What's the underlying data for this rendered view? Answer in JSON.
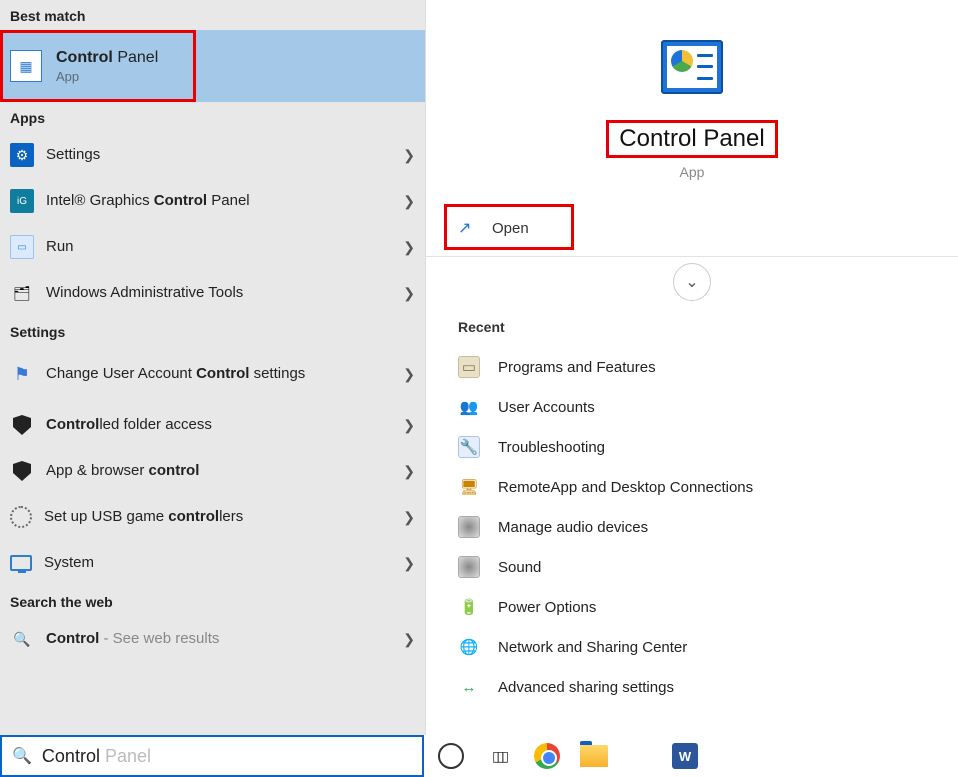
{
  "left": {
    "best_match_header": "Best match",
    "best_match": {
      "title_bold": "Control",
      "title_rest": " Panel",
      "type": "App"
    },
    "apps_header": "Apps",
    "apps": [
      {
        "label_html": "Settings",
        "icon": "settings"
      },
      {
        "label_pre": "Intel® Graphics ",
        "label_bold": "Control",
        "label_post": " Panel",
        "icon": "intel"
      },
      {
        "label_html": "Run",
        "icon": "run"
      },
      {
        "label_html": "Windows Administrative Tools",
        "icon": "admin"
      }
    ],
    "settings_header": "Settings",
    "settings": [
      {
        "pre": "Change User Account ",
        "bold": "Control",
        "post": " settings",
        "icon": "flag",
        "twoline": true
      },
      {
        "bold": "Control",
        "post": "led folder access",
        "icon": "shield"
      },
      {
        "pre": "App & browser ",
        "bold": "control",
        "icon": "shield"
      },
      {
        "pre": "Set up USB game ",
        "bold": "control",
        "post": "lers",
        "icon": "gear"
      },
      {
        "pre": "System",
        "icon": "monitor"
      }
    ],
    "web_header": "Search the web",
    "web": {
      "bold": "Control",
      "rest": " - See web results"
    }
  },
  "right": {
    "title": "Control Panel",
    "subtitle": "App",
    "open_label": "Open",
    "recent_header": "Recent",
    "recent": [
      "Programs and Features",
      "User Accounts",
      "Troubleshooting",
      "RemoteApp and Desktop Connections",
      "Manage audio devices",
      "Sound",
      "Power Options",
      "Network and Sharing Center",
      "Advanced sharing settings"
    ]
  },
  "search": {
    "typed": "Control",
    "ghost": " Panel"
  }
}
